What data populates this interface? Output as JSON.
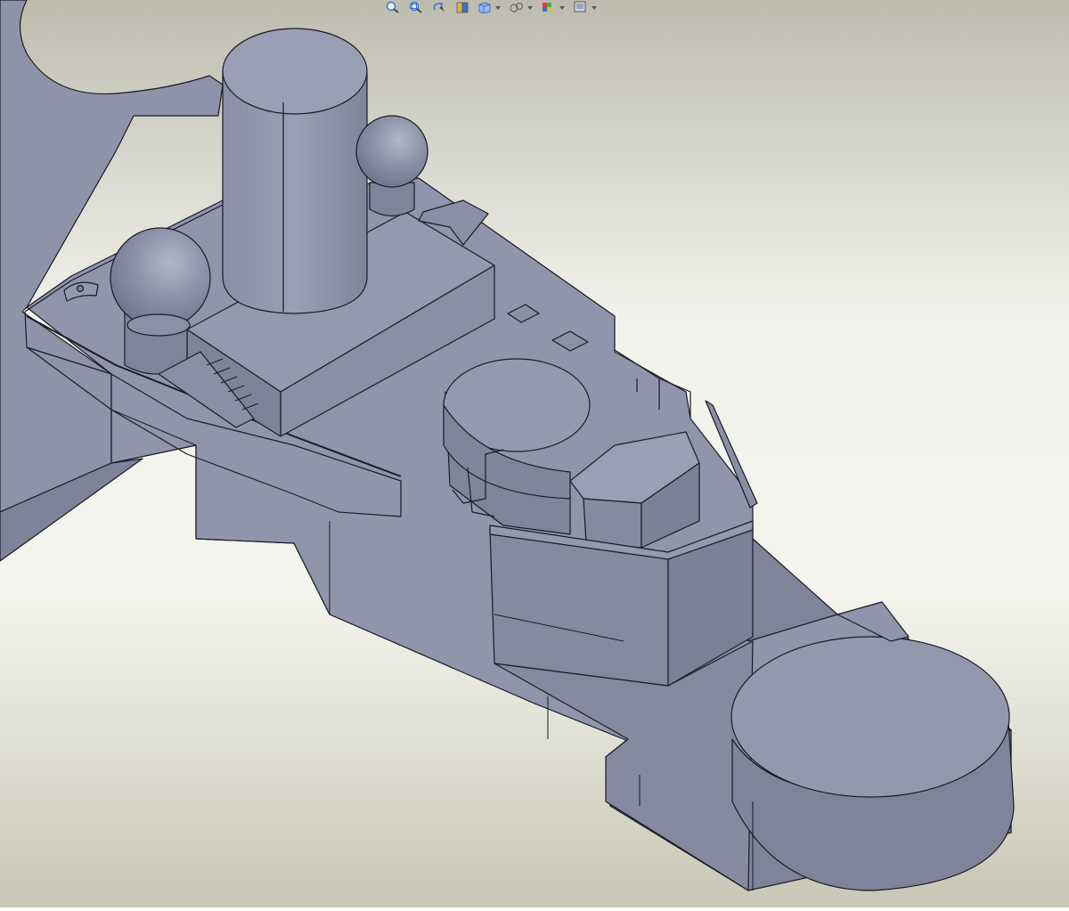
{
  "window": {
    "type": "cad-graphics-area"
  },
  "toolbar": {
    "items": [
      {
        "icon": "zoom-to-fit-icon",
        "has_dropdown": false
      },
      {
        "icon": "zoom-to-area-icon",
        "has_dropdown": false
      },
      {
        "icon": "previous-view-icon",
        "has_dropdown": false
      },
      {
        "icon": "section-view-icon",
        "has_dropdown": false
      },
      {
        "icon": "view-orientation-icon",
        "has_dropdown": true
      },
      {
        "icon": "display-style-icon",
        "has_dropdown": true
      },
      {
        "icon": "hide-show-items-icon",
        "has_dropdown": true
      },
      {
        "icon": "edit-appearance-icon",
        "has_dropdown": true
      },
      {
        "icon": "apply-scene-icon",
        "has_dropdown": true
      }
    ]
  },
  "colors": {
    "background_top": "#b9b7a8",
    "background_mid": "#f4f4ee",
    "background_bottom": "#c6c5b2",
    "model_top": "#9196ad",
    "model_side": "#7d8299",
    "model_dark": "#6d728a",
    "edge": "#1a1a24",
    "accent_blue": "#3a6fd0"
  }
}
